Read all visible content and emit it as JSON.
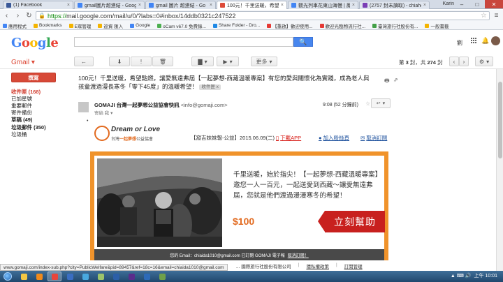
{
  "browser": {
    "tabs": [
      {
        "title": "(1) Facebook",
        "color": "#3b5998",
        "active": false
      },
      {
        "title": "gmail圖片超連結 - Googl",
        "color": "#4285f4",
        "active": false
      },
      {
        "title": "gmail 圖片 超連結 - Go",
        "color": "#4285f4",
        "active": false
      },
      {
        "title": "100元！千里送暖，希望點",
        "color": "#dd4b39",
        "active": true
      },
      {
        "title": "觀光列車花東山海慢 | 鳳",
        "color": "#4285f4",
        "active": false
      },
      {
        "title": "(2757 封未讀取) - chiaho",
        "color": "#7b3fb5",
        "active": false
      }
    ],
    "user": "Karin",
    "url_scheme": "https://",
    "url_rest": "mail.google.com/mail/u/0/?labs=0#inbox/14ddb0321c247522",
    "bookmarks": [
      {
        "label": "應用程式",
        "color": "#4285f4"
      },
      {
        "label": "Bookmarks",
        "color": "#f4b400"
      },
      {
        "label": "E眾管理",
        "color": "#f4b400"
      },
      {
        "label": "巡資 匯入",
        "color": "#f4b400"
      },
      {
        "label": "Google",
        "color": "#4285f4"
      },
      {
        "label": "oCam v67.0 免費錄...",
        "color": "#4caf50"
      },
      {
        "label": "Share Folder - Dro...",
        "color": "#1e88e5"
      },
      {
        "label": "【重啟】歡迎使用...",
        "color": "#e53935"
      },
      {
        "label": "歡迎光臨物流行社...",
        "color": "#e53935"
      },
      {
        "label": "臺灣旅行社股份有...",
        "color": "#43a047"
      },
      {
        "label": "一般書籤",
        "color": "#f4b400"
      }
    ],
    "status_url": "www.gomaji.com/index-sub.php?city=PublicWelfare&pid=89457&ref=18c=16&email=chiaida1010@gmail.com"
  },
  "gmail": {
    "logo_letters": [
      "G",
      "o",
      "o",
      "g",
      "l",
      "e"
    ],
    "label": "Gmail",
    "user_initial": "劉",
    "toolbar": {
      "back": "←",
      "archive": "⬇",
      "spam": "!",
      "delete": "🗑",
      "folder": "▇",
      "labels": "▶",
      "more": "更多"
    },
    "pager": {
      "prefix": "第",
      "current": "3",
      "middle": "封，共",
      "total": "274",
      "suffix": "封"
    },
    "compose": "撰寫",
    "nav": [
      {
        "label": "收件匣 (168)",
        "state": "active"
      },
      {
        "label": "已加星號",
        "state": ""
      },
      {
        "label": "重要郵件",
        "state": ""
      },
      {
        "label": "寄件備份",
        "state": ""
      },
      {
        "label": "草稿 (49)",
        "state": "bold"
      },
      {
        "label": "垃圾郵件 (350)",
        "state": "bold"
      },
      {
        "label": "垃圾桶",
        "state": ""
      }
    ],
    "message": {
      "subject": "100元！千里送暖，希望點燃，讓愛無遠弗屆【一起夢想-西藏溫暖專案】有您的愛與關懷化為實踐，成為老人與孩童渡過漫長寒冬「零下45度」的溫暖希望！",
      "inbox_tag": "收件匣 x",
      "sender_name": "GOMAJI 台灣一起夢想公益協會快訊",
      "sender_email": "<info@gomaji.com>",
      "to": "寄給 我",
      "time": "9:08 (52 分鐘前)"
    }
  },
  "newsletter": {
    "logo_main": "Dream or Love",
    "logo_sub_prefix": "台灣",
    "logo_sub_em": "一起夢想",
    "logo_sub_suffix": "公益協會",
    "issue": "【窩吉妹妹報-公益】2015.06.09(二)",
    "download_app": "下載APP",
    "join_fans": "加入粉絲頁",
    "unsubscribe": "取消訂閱",
    "banner_text": "千里送暖，始於指尖！【一起夢想-西藏溫暖專案】邀您一人一百元，一起送愛到西藏～讓愛無遠弗屆，您就是他們渡過漫漫寒冬的希望！",
    "price": "$100",
    "cta": "立刻幫助",
    "foot_text": "您的 Email：chiaida1010@gmail.com 已訂閱 GOMAJI 電子報",
    "foot_link": "取消訂閱！",
    "footer_company": "... 國際旅行社股份有限公司",
    "footer_privacy": "隱私權政策",
    "footer_manage": "訂閱管理"
  },
  "taskbar": {
    "apps": [
      {
        "name": "explorer",
        "color": "#f3c744"
      },
      {
        "name": "media",
        "color": "#f18a1b"
      },
      {
        "name": "chrome",
        "color": "#e8453c"
      },
      {
        "name": "firefox",
        "color": "#3a6ec2"
      },
      {
        "name": "chat",
        "color": "#49a9e0"
      },
      {
        "name": "mail",
        "color": "#9cc36b"
      },
      {
        "name": "photoshop",
        "color": "#2c5fa8"
      },
      {
        "name": "premiere",
        "color": "#5a2d8c"
      },
      {
        "name": "word",
        "color": "#2d6ab8"
      },
      {
        "name": "cleaner",
        "color": "#6fa04a"
      }
    ],
    "clock": "上午 10:01"
  }
}
